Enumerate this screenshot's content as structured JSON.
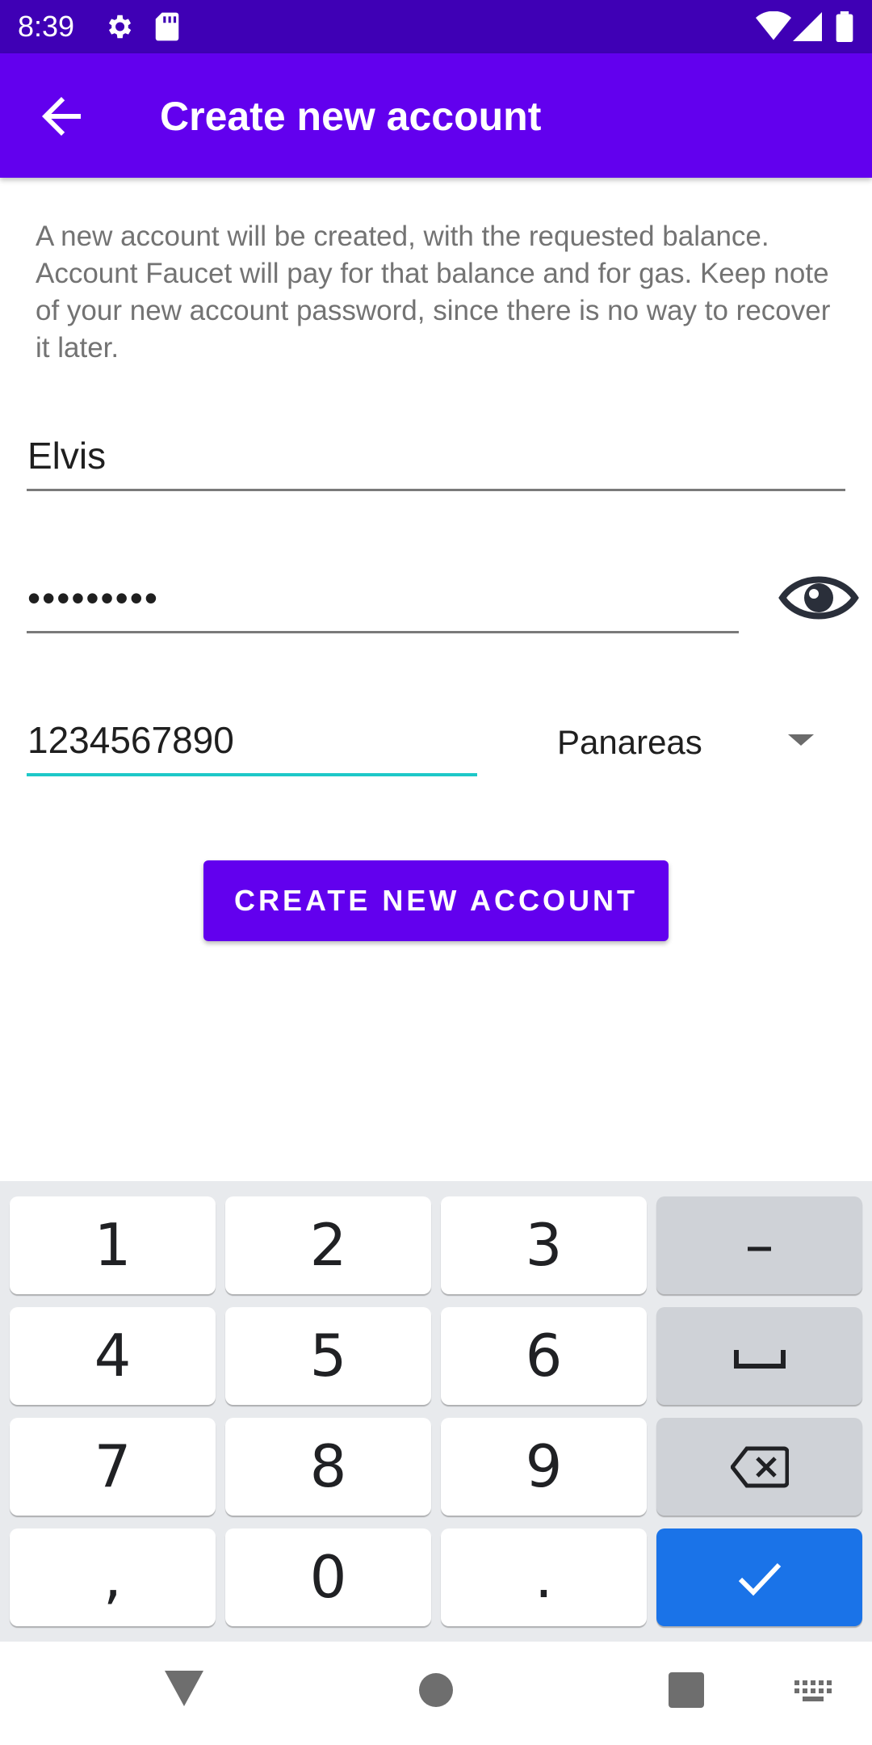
{
  "status_bar": {
    "time": "8:39",
    "icons": [
      "gear-icon",
      "sd-card-icon",
      "wifi-icon",
      "signal-icon",
      "battery-icon"
    ]
  },
  "app_bar": {
    "title": "Create new account",
    "back_icon": "arrow-back-icon"
  },
  "description": "A new account will be created, with the requested balance. Account Faucet will pay for that balance and for gas. Keep note of your new account password, since there is no way to recover it later.",
  "form": {
    "username_value": "Elvis",
    "password_value": "•••••••••",
    "balance_value": "1234567890",
    "unit_selected": "Panareas",
    "create_button_label": "CREATE NEW ACCOUNT"
  },
  "keyboard": {
    "keys": [
      "1",
      "2",
      "3",
      "–",
      "4",
      "5",
      "6",
      "␣",
      "7",
      "8",
      "9",
      "⌫",
      ",",
      "0",
      ".",
      "✓"
    ]
  },
  "colors": {
    "status_bar": "#3f00b5",
    "primary": "#6200ee",
    "accent_underline": "#1ec8c8",
    "keyboard_enter": "#1a73e8"
  }
}
